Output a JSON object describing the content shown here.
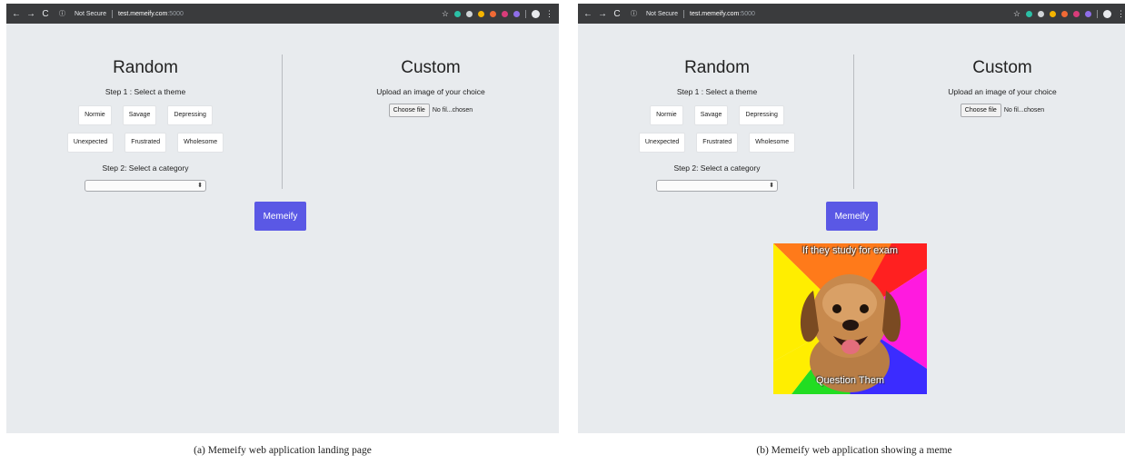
{
  "browser": {
    "security_label": "Not Secure",
    "url_host": "test.memeify.com",
    "url_port": ":5000",
    "back_icon": "←",
    "forward_icon": "→",
    "reload_icon": "C",
    "info_icon": "ⓘ",
    "star_icon": "☆",
    "menu_icon": "⋮",
    "extension_colors": [
      "#2bc0a6",
      "#cfd3d6",
      "#f4b400",
      "#f06a35",
      "#d93c7a",
      "#8f6ee8",
      "#c4c7cb"
    ]
  },
  "app": {
    "random_heading": "Random",
    "step1_label": "Step 1 : Select a theme",
    "themes_row1": [
      "Normie",
      "Savage",
      "Depressing"
    ],
    "themes_row2": [
      "Unexpected",
      "Frustrated",
      "Wholesome"
    ],
    "step2_label": "Step 2: Select a category",
    "select_arrows": "⬍",
    "custom_heading": "Custom",
    "upload_label": "Upload an image of your choice",
    "choose_file_label": "Choose file",
    "file_status": "No fil...chosen",
    "memeify_label": "Memeify",
    "accent_color": "#5a58e5"
  },
  "meme": {
    "top_text": "If they study for exam",
    "bottom_text": "Question Them"
  },
  "captions": {
    "a": "(a)  Memeify web application landing page",
    "b": "(b)  Memeify web application showing a meme"
  }
}
